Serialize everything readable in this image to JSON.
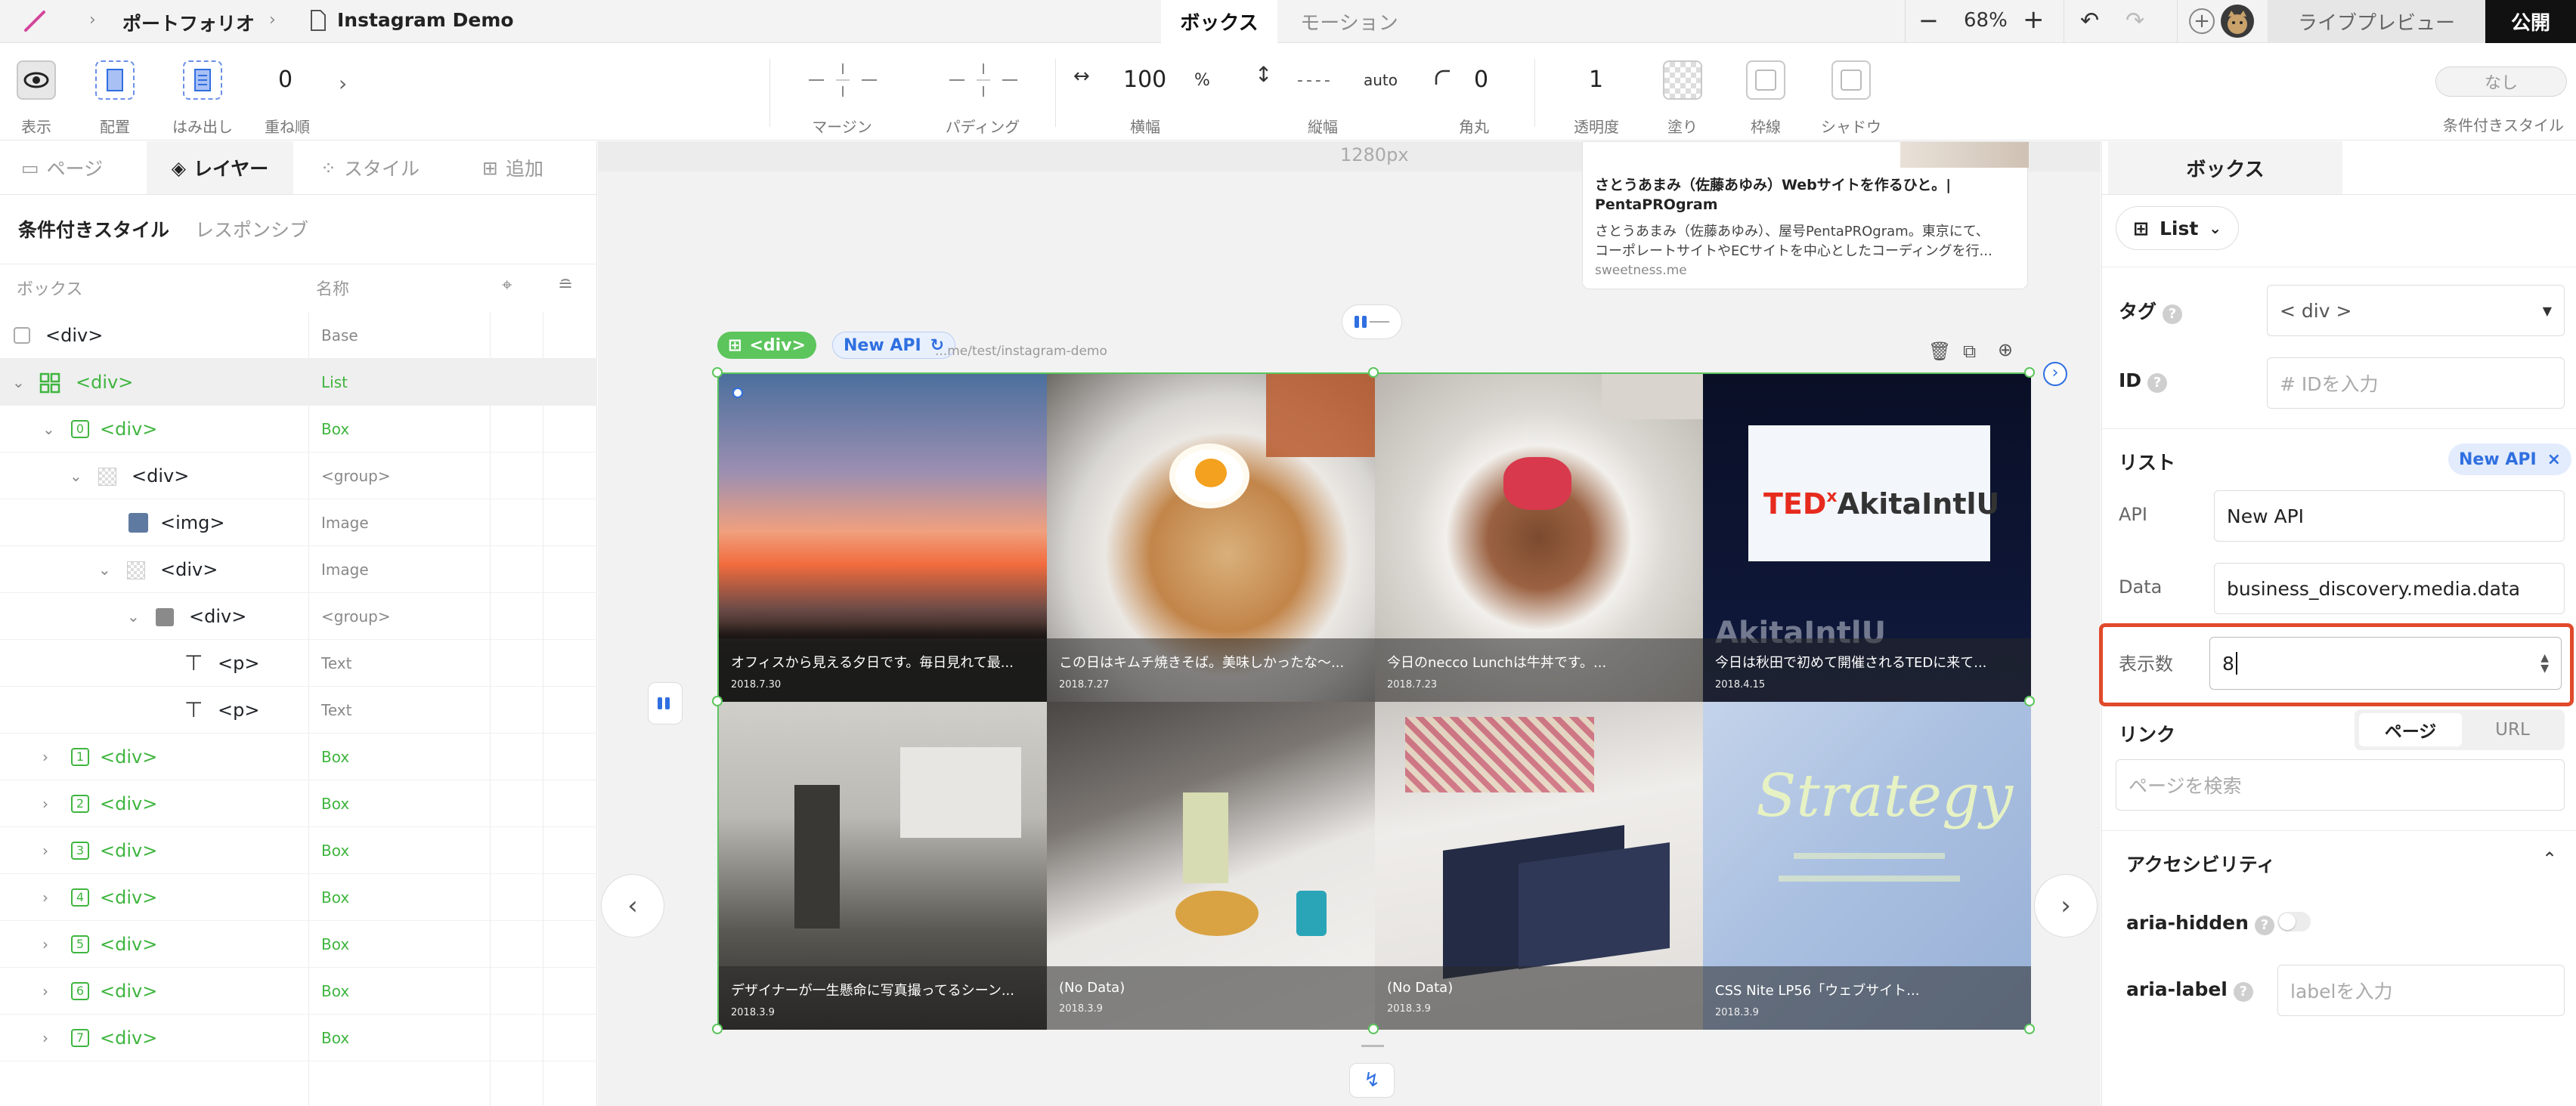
{
  "topbar": {
    "breadcrumb": [
      "ポートフォリオ",
      "Instagram Demo"
    ],
    "modes": [
      "ボックス",
      "モーション"
    ],
    "zoom": "68%",
    "live_preview": "ライブプレビュー",
    "publish": "公開"
  },
  "toolbar": {
    "display": "表示",
    "layout": "配置",
    "overflow": "はみ出し",
    "zorder_value": "0",
    "zorder": "重ね順",
    "margin": "マージン",
    "padding": "パディング",
    "width_value": "100",
    "width_unit": "%",
    "width": "横幅",
    "height_value": "auto",
    "height": "縦幅",
    "radius_value": "0",
    "radius": "角丸",
    "opacity_value": "1",
    "opacity": "透明度",
    "fill": "塗り",
    "border": "枠線",
    "shadow": "シャドウ",
    "cond_value": "なし",
    "cond": "条件付きスタイル"
  },
  "left": {
    "tabs": [
      "ページ",
      "レイヤー",
      "スタイル",
      "追加"
    ],
    "subtabs": [
      "条件付きスタイル",
      "レスポンシブ"
    ],
    "col_box": "ボックス",
    "col_name": "名称",
    "layers": [
      {
        "tag": "<div>",
        "kind": "Base"
      },
      {
        "tag": "<div>",
        "kind": "List"
      },
      {
        "idx": "0",
        "tag": "<div>",
        "kind": "Box"
      },
      {
        "tag": "<div>",
        "kind": "<group>"
      },
      {
        "tag": "<img>",
        "kind": "Image"
      },
      {
        "tag": "<div>",
        "kind": "Image"
      },
      {
        "tag": "<div>",
        "kind": "<group>"
      },
      {
        "tag": "<p>",
        "kind": "Text"
      },
      {
        "tag": "<p>",
        "kind": "Text"
      },
      {
        "idx": "1",
        "tag": "<div>",
        "kind": "Box"
      },
      {
        "idx": "2",
        "tag": "<div>",
        "kind": "Box"
      },
      {
        "idx": "3",
        "tag": "<div>",
        "kind": "Box"
      },
      {
        "idx": "4",
        "tag": "<div>",
        "kind": "Box"
      },
      {
        "idx": "5",
        "tag": "<div>",
        "kind": "Box"
      },
      {
        "idx": "6",
        "tag": "<div>",
        "kind": "Box"
      },
      {
        "idx": "7",
        "tag": "<div>",
        "kind": "Box"
      }
    ]
  },
  "canvas": {
    "ruler": "1280px",
    "sel_tag": "<div>",
    "sel_api": "New API",
    "url": "...me/test/instagram-demo",
    "card": {
      "title": "さとうあまみ（佐藤あゆみ）Webサイトを作るひと。|",
      "title2": "PentaPROgram",
      "desc1": "さとうあまみ（佐藤あゆみ）、屋号PentaPROgram。東京にて、",
      "desc2": "コーポレートサイトやECサイトを中心としたコーディングを行...",
      "site": "sweetness.me"
    },
    "posts": [
      {
        "text": "オフィスから見える夕日です。毎日見れて最...",
        "date": "2018.7.30"
      },
      {
        "text": "この日はキムチ焼きそば。美味しかったな〜...",
        "date": "2018.7.27"
      },
      {
        "text": "今日のnecco Lunchは牛丼です。...",
        "date": "2018.7.23"
      },
      {
        "text": "今日は秋田で初めて開催されるTEDに来て...",
        "date": "2018.4.15"
      },
      {
        "text": "デザイナーが一生懸命に写真撮ってるシーン...",
        "date": "2018.3.9"
      },
      {
        "text": "(No Data)",
        "date": "2018.3.9"
      },
      {
        "text": "(No Data)",
        "date": "2018.3.9"
      },
      {
        "text": "CSS Nite LP56「ウェブサイト...",
        "date": "2018.3.9"
      }
    ],
    "ted_text": "TEDxAkitaIntlU",
    "strategy_text": "Strategy"
  },
  "right": {
    "tab": "ボックス",
    "type": "List",
    "tag_label": "タグ",
    "tag_value": "< div >",
    "id_label": "ID",
    "id_placeholder": "#  IDを入力",
    "list_label": "リスト",
    "list_badge": "New API",
    "api_label": "API",
    "api_value": "New API",
    "data_label": "Data",
    "data_value": "business_discovery.media.data",
    "count_label": "表示数",
    "count_value": "8",
    "link_label": "リンク",
    "link_page": "ページ",
    "link_url": "URL",
    "link_placeholder": "ページを検索",
    "a11y_label": "アクセシビリティ",
    "aria_hidden": "aria-hidden",
    "aria_label": "aria-label",
    "aria_label_placeholder": "labelを入力"
  },
  "colors": {
    "accent_green": "#3fb53f",
    "highlight_red": "#e04a2a",
    "api_blue": "#2f6fe0"
  }
}
